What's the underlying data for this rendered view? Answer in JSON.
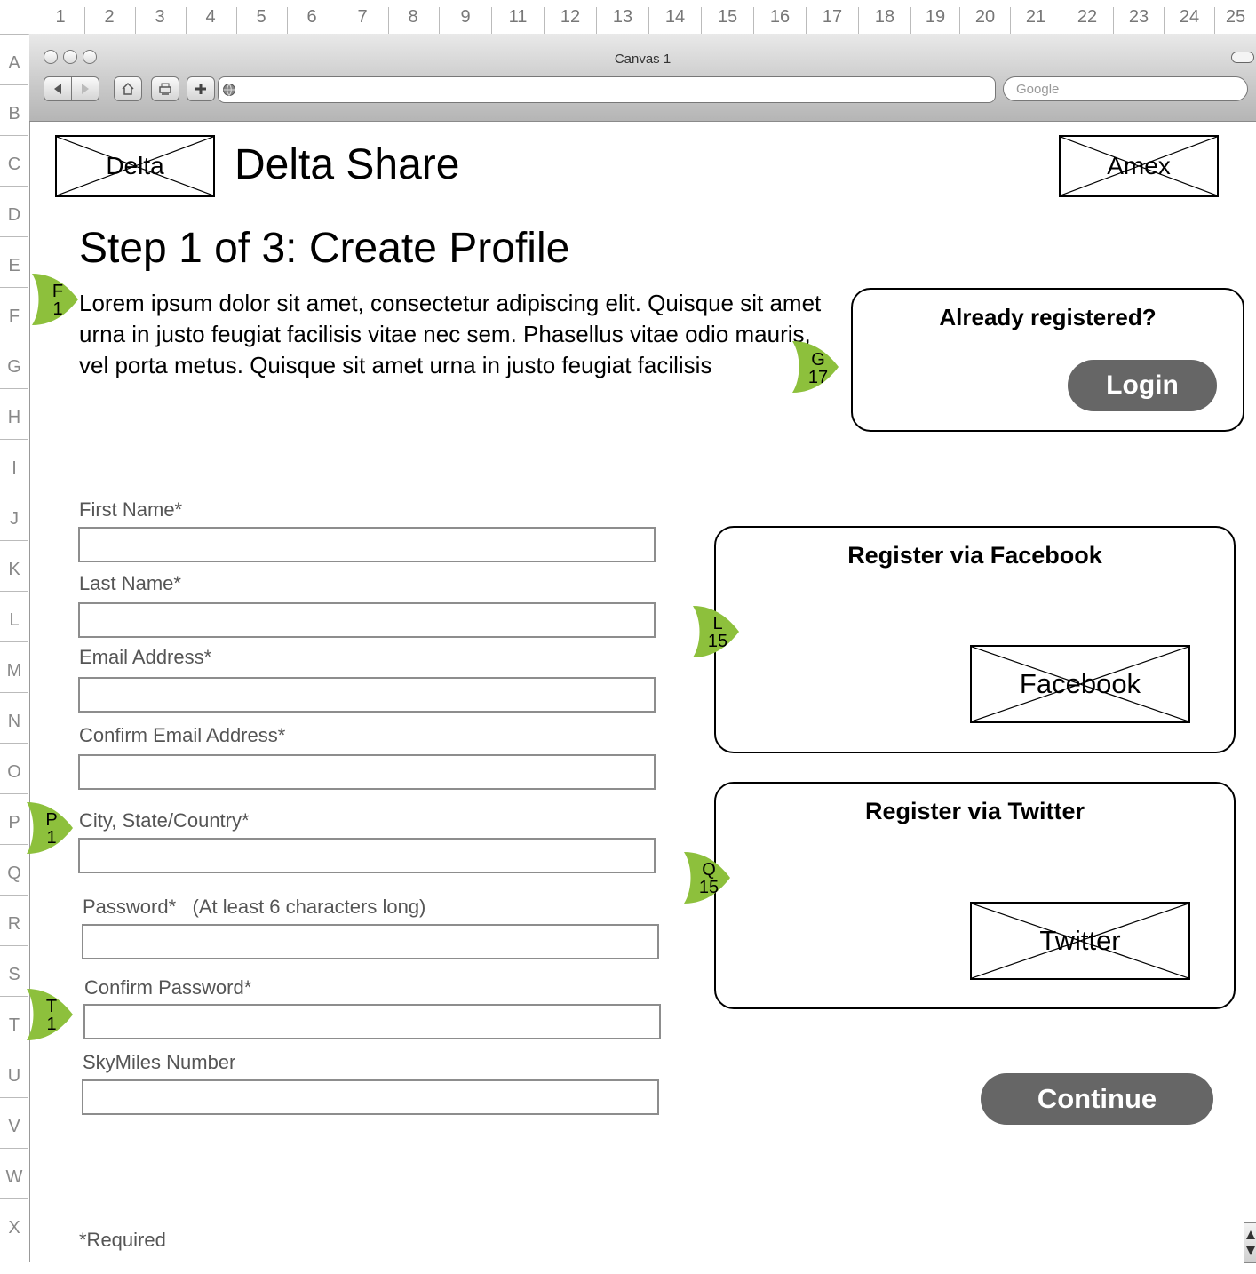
{
  "rulers": {
    "columns": [
      "1",
      "2",
      "3",
      "4",
      "5",
      "6",
      "7",
      "8",
      "9",
      "11",
      "12",
      "13",
      "14",
      "15",
      "16",
      "17",
      "18",
      "19",
      "20",
      "21",
      "22",
      "23",
      "24",
      "25"
    ],
    "rows": [
      "A",
      "B",
      "C",
      "D",
      "E",
      "F",
      "G",
      "H",
      "I",
      "J",
      "K",
      "L",
      "M",
      "N",
      "O",
      "P",
      "Q",
      "R",
      "S",
      "T",
      "U",
      "V",
      "W",
      "X"
    ]
  },
  "window": {
    "title": "Canvas 1",
    "search_placeholder": "Google"
  },
  "header": {
    "logo_left": "Delta",
    "site_title": "Delta Share",
    "logo_right": "Amex"
  },
  "page": {
    "heading": "Step 1 of 3: Create Profile",
    "intro": "Lorem ipsum dolor sit amet, consectetur adipiscing elit. Quisque sit amet urna in justo feugiat facilisis vitae nec sem. Phasellus vitae odio mauris, vel porta metus. Quisque sit amet urna in justo feugiat facilisis",
    "required_note": "*Required"
  },
  "form": {
    "fields": [
      {
        "label": "First Name*",
        "value": ""
      },
      {
        "label": "Last Name*",
        "value": ""
      },
      {
        "label": "Email Address*",
        "value": ""
      },
      {
        "label": "Confirm Email Address*",
        "value": ""
      },
      {
        "label": "City, State/Country*",
        "value": ""
      },
      {
        "label": "Password*   (At least 6 characters long)",
        "value": ""
      },
      {
        "label": "Confirm Password*",
        "value": ""
      },
      {
        "label": "SkyMiles Number",
        "value": ""
      }
    ]
  },
  "login_panel": {
    "title": "Already registered?",
    "button": "Login"
  },
  "facebook_panel": {
    "title": "Register via Facebook",
    "image_label": "Facebook"
  },
  "twitter_panel": {
    "title": "Register via Twitter",
    "image_label": "Twitter"
  },
  "continue_button": "Continue",
  "annotations": [
    {
      "row": "F",
      "col": "1"
    },
    {
      "row": "G",
      "col": "17"
    },
    {
      "row": "L",
      "col": "15"
    },
    {
      "row": "P",
      "col": "1"
    },
    {
      "row": "Q",
      "col": "15"
    },
    {
      "row": "T",
      "col": "1"
    }
  ],
  "colors": {
    "annotation_green": "#8dc03c",
    "button_gray": "#666666"
  }
}
